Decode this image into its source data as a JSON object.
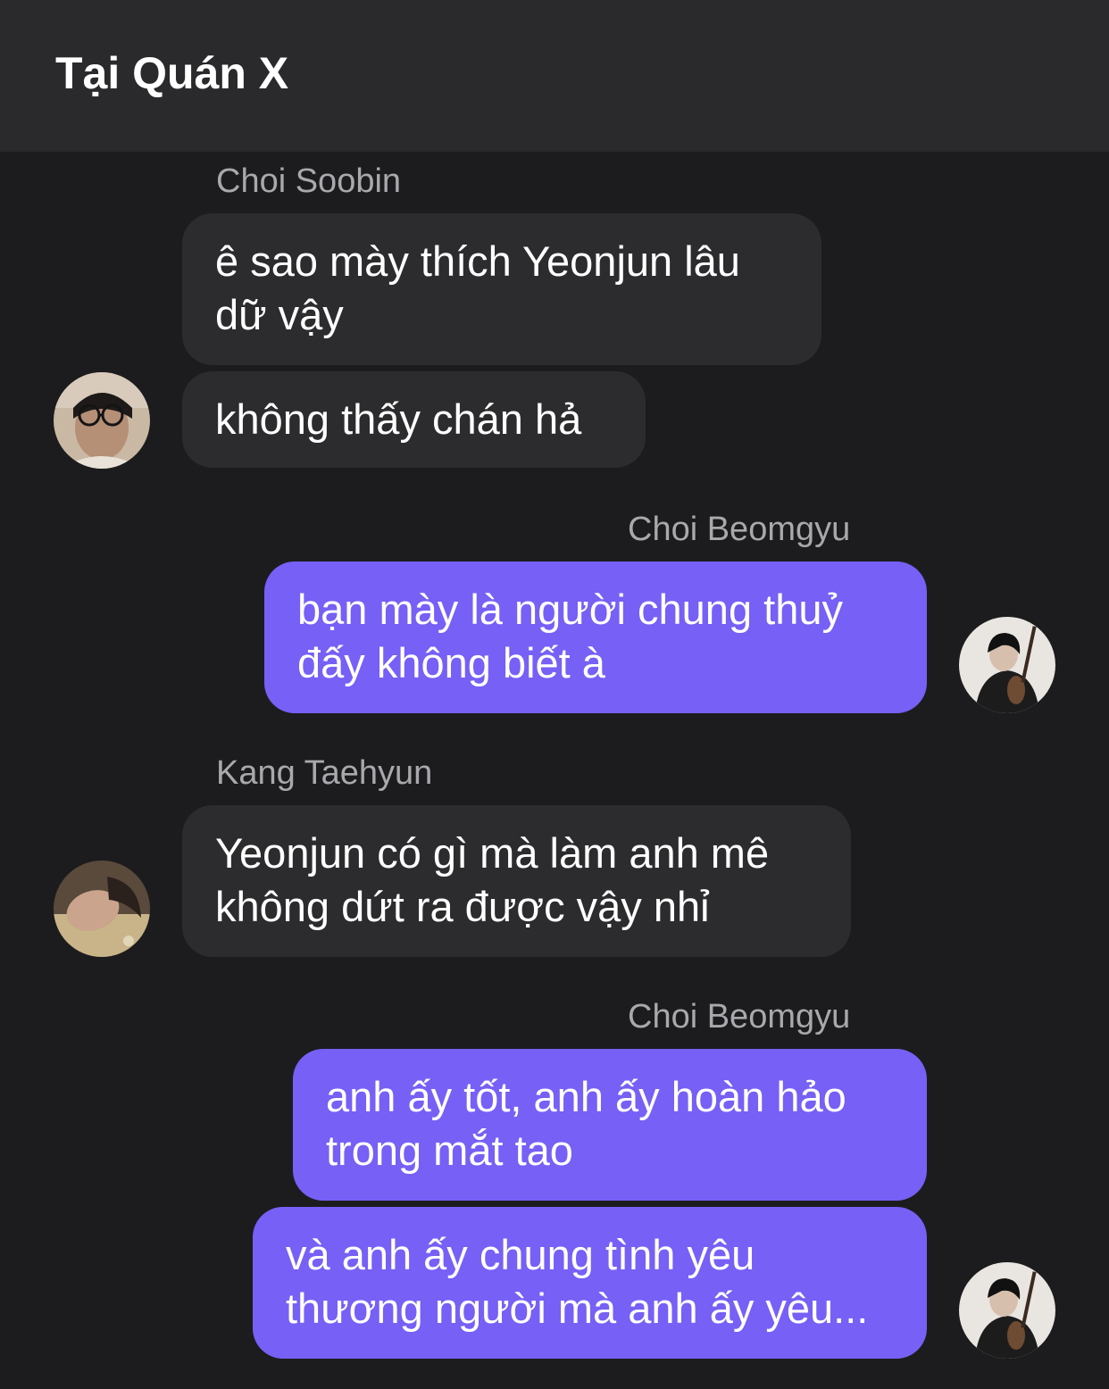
{
  "header": {
    "title": "Tại Quán X"
  },
  "messages": [
    {
      "sender": "Choi Soobin",
      "text": "ê sao mày thích Yeonjun lâu\ndữ vậy",
      "direction": "incoming"
    },
    {
      "sender": "Choi Soobin",
      "text": "không thấy chán hả",
      "direction": "incoming"
    },
    {
      "sender": "Choi Beomgyu",
      "text": "bạn mày là người chung thuỷ\nđấy không biết à",
      "direction": "outgoing"
    },
    {
      "sender": "Kang Taehyun",
      "text": "Yeonjun có gì mà làm anh mê\nkhông dứt ra được vậy nhỉ",
      "direction": "incoming"
    },
    {
      "sender": "Choi Beomgyu",
      "text": "anh ấy tốt, anh ấy hoàn hảo\ntrong mắt tao",
      "direction": "outgoing"
    },
    {
      "sender": "Choi Beomgyu",
      "text": "và anh ấy chung tình yêu\nthương người mà anh ấy yêu...",
      "direction": "outgoing"
    }
  ],
  "colors": {
    "background": "#1c1c1e",
    "header": "#2a2a2c",
    "incoming_bubble": "#2c2c2e",
    "outgoing_bubble": "#7660f6",
    "sender_name": "#a8a8ad"
  }
}
